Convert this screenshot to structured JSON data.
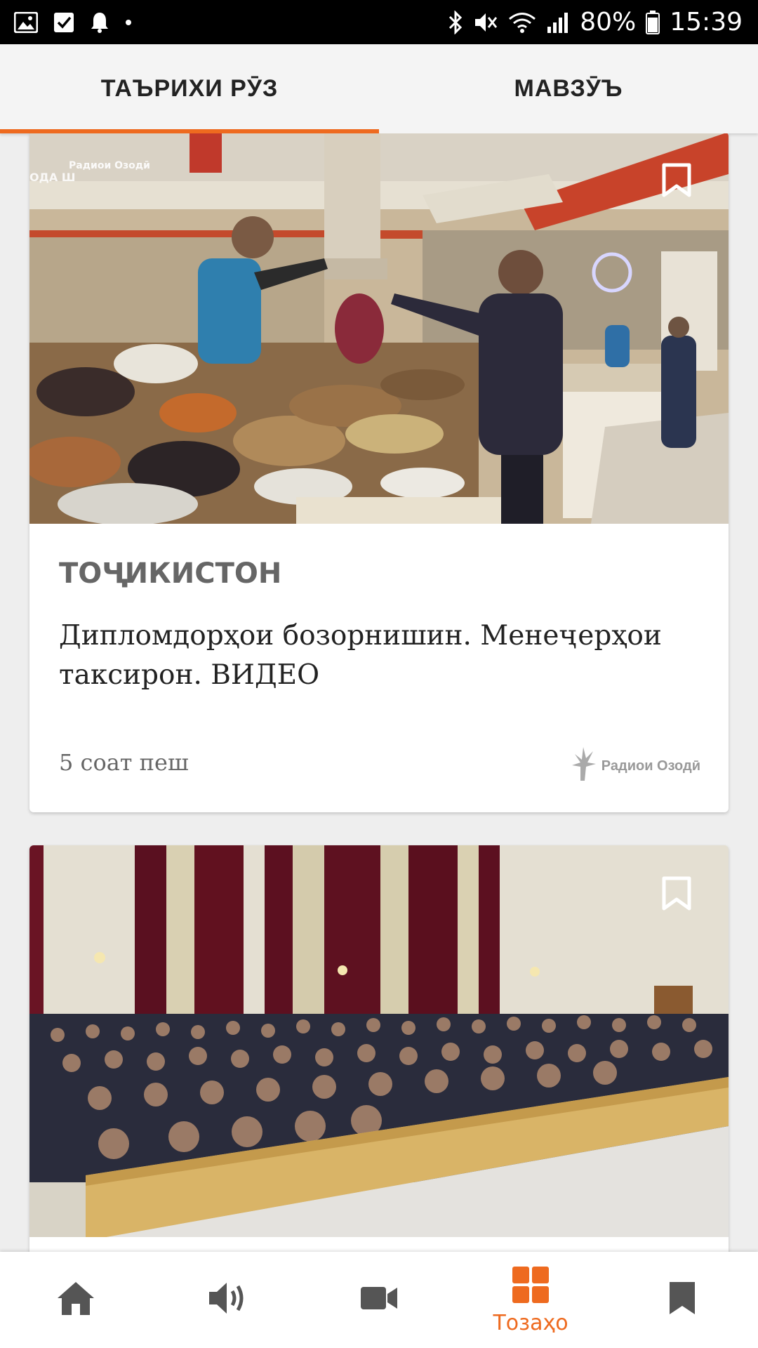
{
  "status_bar": {
    "battery": "80%",
    "time": "15:39",
    "icons": [
      "image-icon",
      "check-icon",
      "bell-icon",
      "dot-icon",
      "bluetooth-icon",
      "mute-icon",
      "wifi-icon",
      "signal-icon",
      "battery-icon"
    ]
  },
  "tabs": [
    {
      "label": "ТАЪРИХИ РӮЗ",
      "active": true
    },
    {
      "label": "МАВЗӮЪ",
      "active": false
    }
  ],
  "articles": [
    {
      "category": "ТОҶИКИСТОН",
      "headline": "Дипломдорҳои бозорнишин. Менеҷерҳои таксирон. ВИДЕО",
      "time": "5 соат пеш",
      "source": "Радиои Озодӣ",
      "image_watermark": "Радиои Озодӣ",
      "image_sign": "ОДА Ш"
    },
    {
      "category": "",
      "headline": "",
      "time": ""
    }
  ],
  "bottom_nav": {
    "items": [
      {
        "icon": "home-icon",
        "label": ""
      },
      {
        "icon": "audio-icon",
        "label": ""
      },
      {
        "icon": "video-icon",
        "label": ""
      },
      {
        "icon": "grid-icon",
        "label": "Тозаҳо",
        "active": true
      },
      {
        "icon": "bookmark-icon",
        "label": ""
      }
    ]
  },
  "colors": {
    "accent": "#ee6a1f",
    "nav_icon": "#555555",
    "statusbar_bg": "#000000"
  }
}
